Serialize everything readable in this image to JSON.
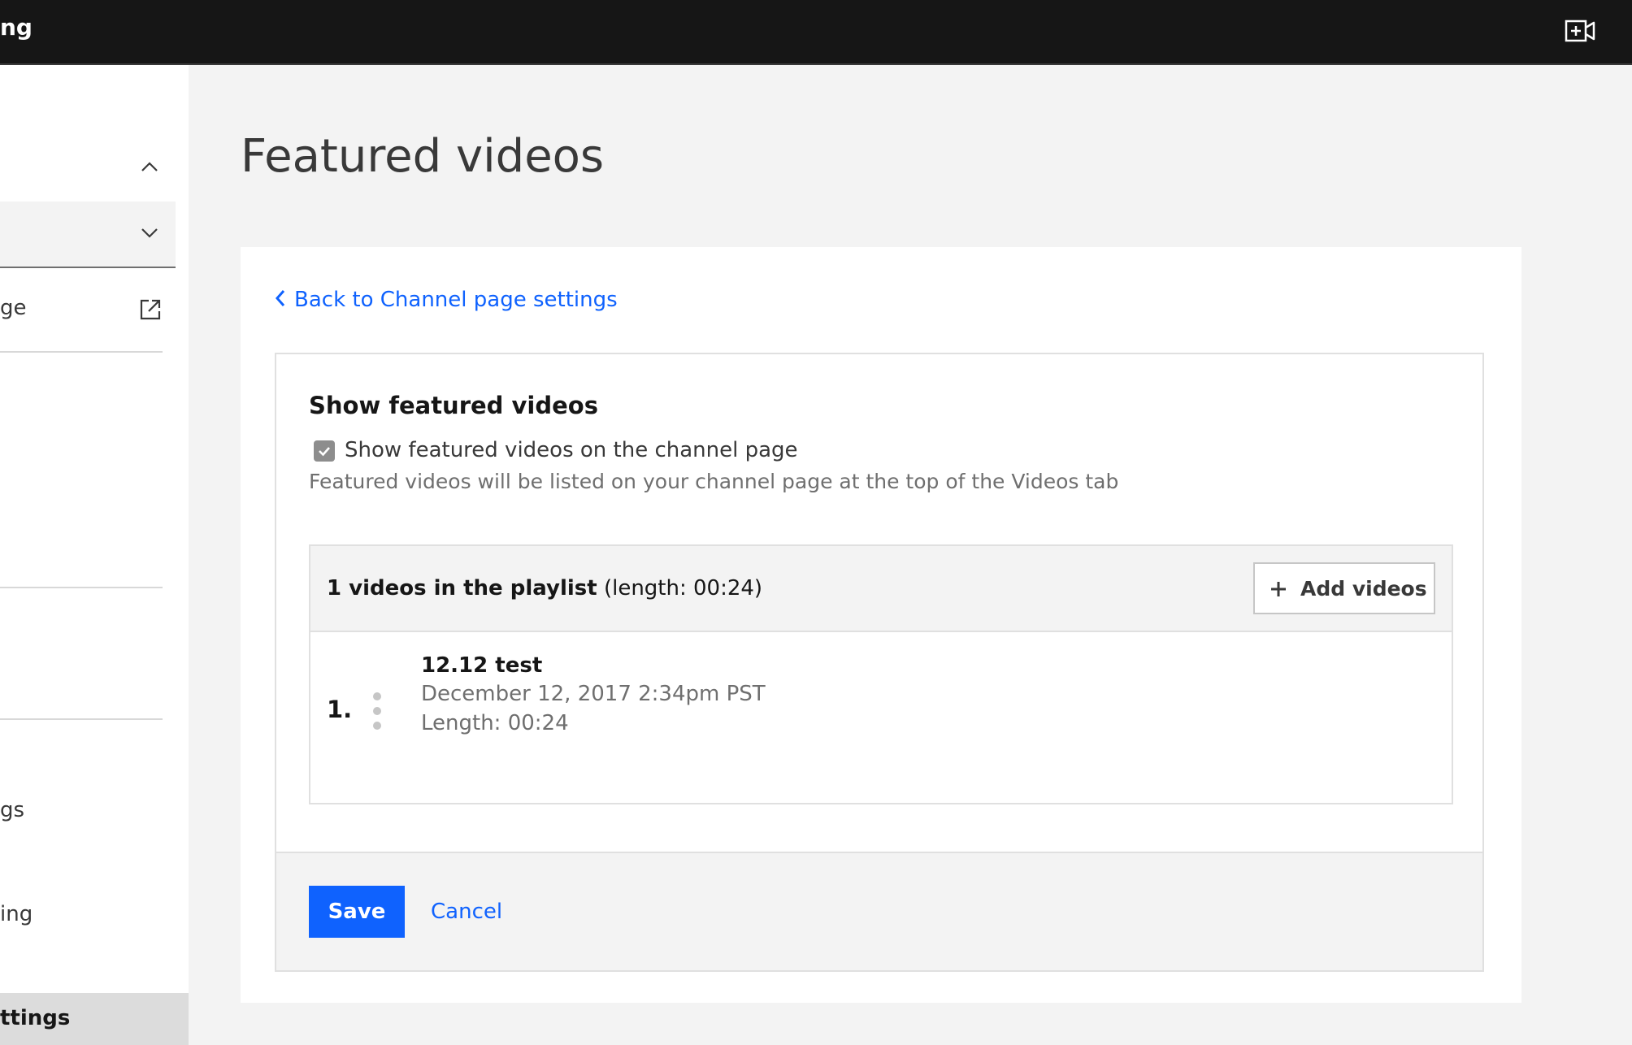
{
  "header": {
    "title": "ng",
    "video_icon": "video-add-icon"
  },
  "sidebar": {
    "items": [
      {
        "label": "ge",
        "icon": "launch-icon"
      },
      {
        "label": "gs"
      },
      {
        "label": "ing"
      }
    ],
    "active_item": "ttings"
  },
  "main": {
    "page_title": "Featured videos",
    "back_link": "Back to Channel page settings",
    "section_heading": "Show featured videos",
    "checkbox": {
      "label": "Show featured videos on the channel page",
      "checked": true
    },
    "helper_text": "Featured videos will be listed on your channel page at the top of the Videos tab",
    "playlist": {
      "count_text": "1 videos in the playlist",
      "length_text": "(length: 00:24)",
      "add_button_label": "Add videos",
      "videos": [
        {
          "index": "1.",
          "title": "12.12 test",
          "date": "December 12, 2017 2:34pm PST",
          "length": "Length: 00:24"
        }
      ]
    },
    "footer": {
      "save_label": "Save",
      "cancel_label": "Cancel"
    }
  },
  "colors": {
    "accent": "#0f62fe",
    "header_bg": "#161616",
    "page_bg": "#f3f3f3"
  }
}
